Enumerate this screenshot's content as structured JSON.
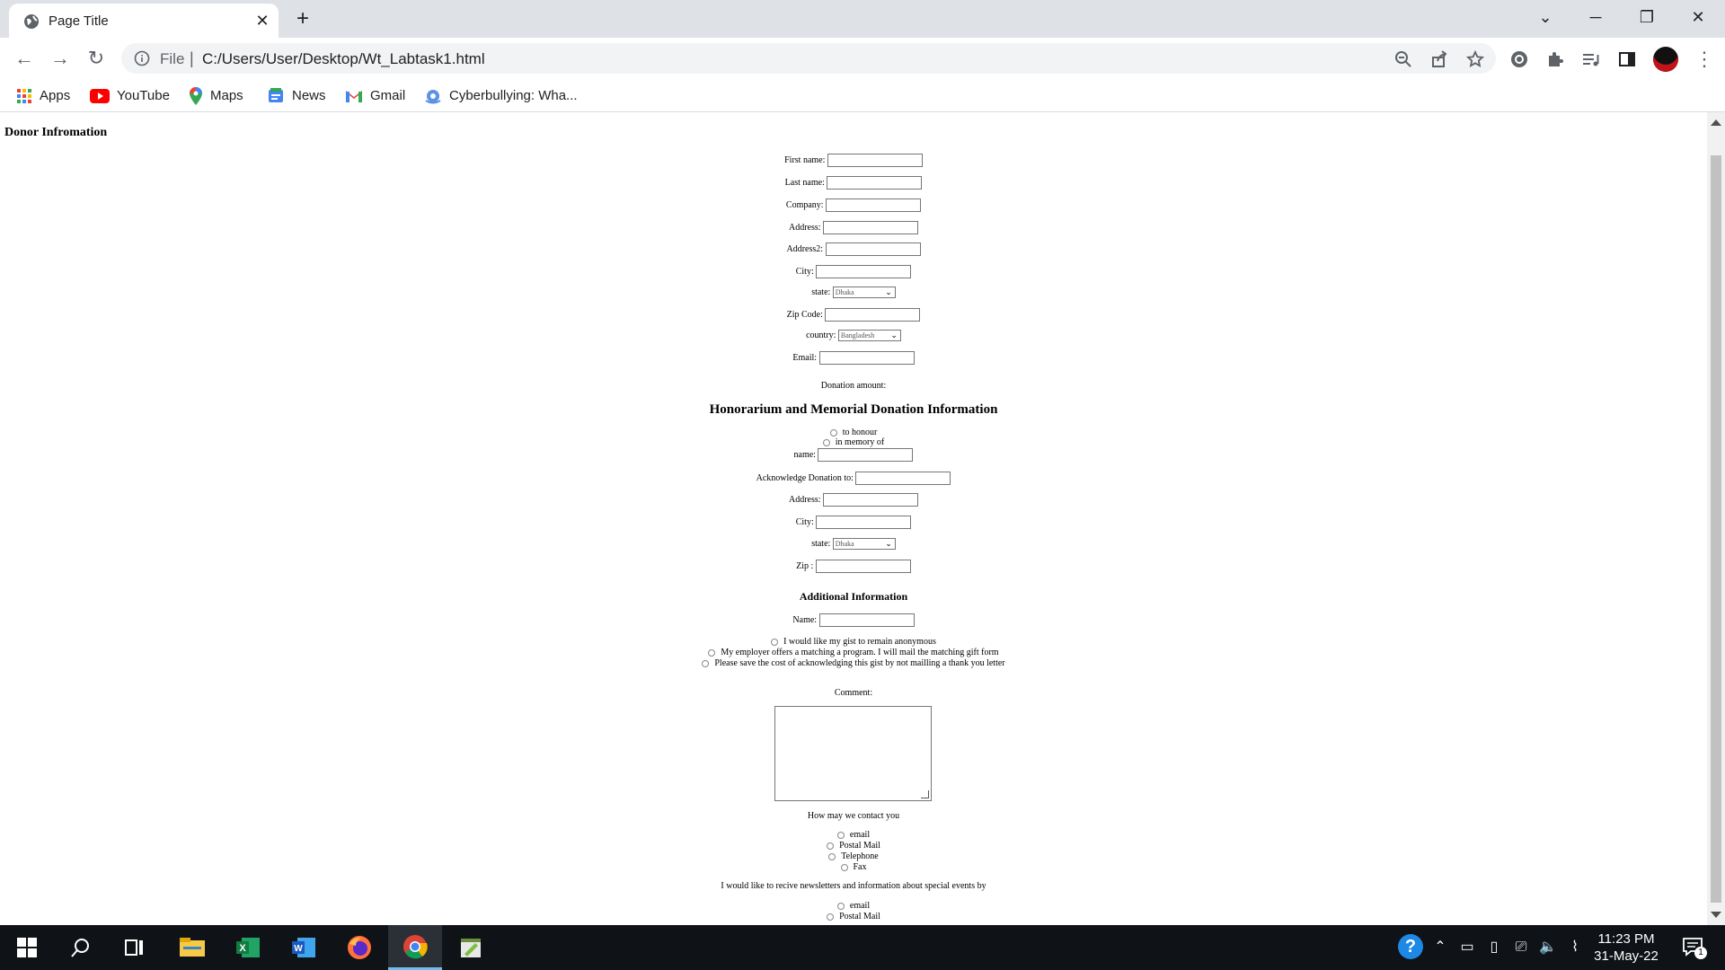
{
  "browser": {
    "tab_title": "Page Title",
    "scheme": "File",
    "url": "C:/Users/User/Desktop/Wt_Labtask1.html",
    "bookmarks": [
      "Apps",
      "YouTube",
      "Maps",
      "News",
      "Gmail",
      "Cyberbullying: Wha..."
    ]
  },
  "page": {
    "donor_heading": "Donor Infromation",
    "donor_fields": {
      "first_name": "First name:",
      "last_name": "Last name:",
      "company": "Company:",
      "address": "Address:",
      "address2": "Address2:",
      "city": "City:",
      "state": "state:",
      "state_value": "Dhaka",
      "zip": "Zip Code:",
      "country": "country:",
      "country_value": "Bangladesh",
      "email": "Email:"
    },
    "donation_amount": "Donation amount:",
    "honorarium_heading": "Honorarium and Memorial Donation Information",
    "honor_options": [
      "to honour",
      "in memory of"
    ],
    "honor_fields": {
      "name": "name:",
      "acknowledge": "Acknowledge Donation to:",
      "address": "Address:",
      "city": "City:",
      "state": "state:",
      "state_value": "Dhaka",
      "zip": "Zip :"
    },
    "additional_heading": "Additional Information",
    "additional_name": "Name:",
    "additional_options": [
      "I would like my gist to remain anonymous",
      "My employer offers a matching a program. I will mail the matching gift form",
      "Please save the cost of acknowledging this gist by not mailling a thank you letter"
    ],
    "comment_label": "Comment:",
    "contact_label": "How may we contact you",
    "contact_options": [
      "email",
      "Postal Mail",
      "Telephone",
      "Fax"
    ],
    "newsletter_label": "I would like to recive newsletters and information about special events by",
    "newsletter_options": [
      "email",
      "Postal Mail"
    ]
  },
  "taskbar": {
    "time": "11:23 PM",
    "date": "31-May-22",
    "notification_count": "1"
  }
}
